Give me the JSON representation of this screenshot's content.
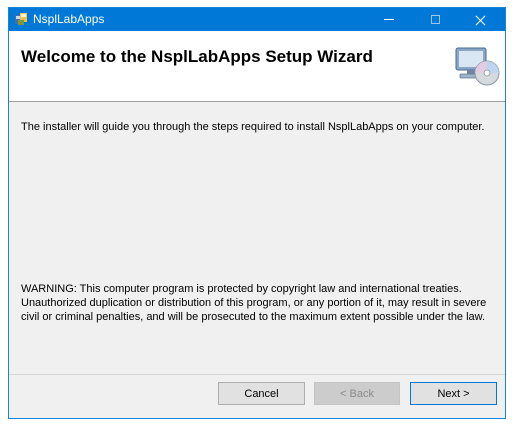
{
  "window": {
    "title": "NsplLabApps",
    "controls": {
      "minimize_icon": "minimize-icon",
      "maximize_icon": "maximize-icon",
      "close_icon": "close-icon"
    },
    "accent_color": "#0078d7"
  },
  "banner": {
    "title": "Welcome to the NsplLabApps Setup Wizard",
    "icon": "computer-cd-icon"
  },
  "body": {
    "intro": "The installer will guide you through the steps required to install NsplLabApps on your computer.",
    "warning": "WARNING: This computer program is protected by copyright law and international treaties. Unauthorized duplication or distribution of this program, or any portion of it, may result in severe civil or criminal penalties, and will be prosecuted to the maximum extent possible under the law."
  },
  "buttons": {
    "cancel": "Cancel",
    "back": "< Back",
    "next": "Next >"
  }
}
